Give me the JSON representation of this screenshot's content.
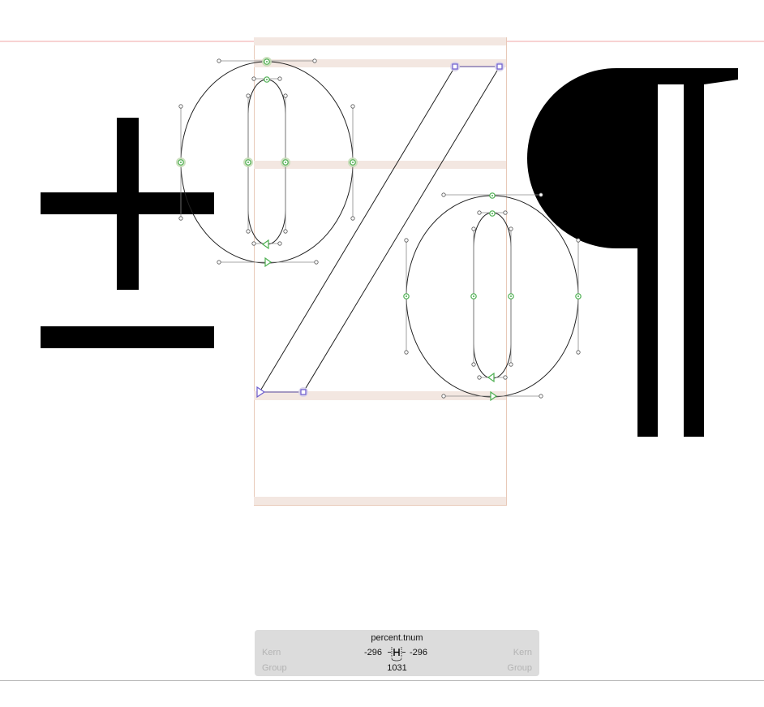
{
  "glyph": {
    "name": "percent.tnum",
    "lsb": "-296",
    "rsb": "-296",
    "width": "1031"
  },
  "panel": {
    "kern_left_label": "Kern",
    "kern_right_label": "Kern",
    "group_left_label": "Group",
    "group_right_label": "Group"
  },
  "neighbors": {
    "left_glyph": "plusminus",
    "right_glyph": "paragraph"
  },
  "colors": {
    "guideline": "#f2a6a6",
    "metric_band": "#f3e7e1",
    "glyph_box": "#e8c9b8",
    "on_curve_node": "#4caf50",
    "corner_node": "#6a5acd",
    "outline": "#222222",
    "panel_bg": "#dcdcdc"
  }
}
